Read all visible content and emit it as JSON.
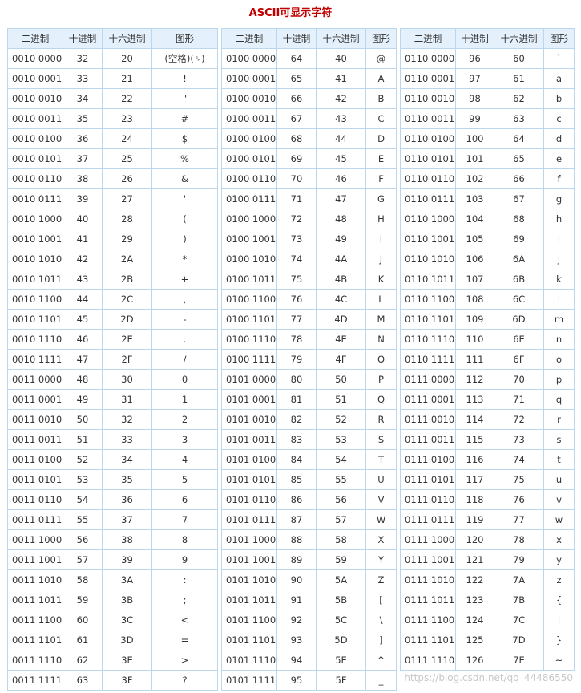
{
  "page": {
    "title": "ASCII可显示字符",
    "watermark": "https://blog.csdn.net/qq_44486550"
  },
  "headers": [
    "二进制",
    "十进制",
    "十六进制",
    "图形"
  ],
  "tables": [
    {
      "rows": [
        [
          "0010 0000",
          "32",
          "20",
          "(空格)(␠)"
        ],
        [
          "0010 0001",
          "33",
          "21",
          "!"
        ],
        [
          "0010 0010",
          "34",
          "22",
          "\""
        ],
        [
          "0010 0011",
          "35",
          "23",
          "#"
        ],
        [
          "0010 0100",
          "36",
          "24",
          "$"
        ],
        [
          "0010 0101",
          "37",
          "25",
          "%"
        ],
        [
          "0010 0110",
          "38",
          "26",
          "&"
        ],
        [
          "0010 0111",
          "39",
          "27",
          "'"
        ],
        [
          "0010 1000",
          "40",
          "28",
          "("
        ],
        [
          "0010 1001",
          "41",
          "29",
          ")"
        ],
        [
          "0010 1010",
          "42",
          "2A",
          "*"
        ],
        [
          "0010 1011",
          "43",
          "2B",
          "+"
        ],
        [
          "0010 1100",
          "44",
          "2C",
          ","
        ],
        [
          "0010 1101",
          "45",
          "2D",
          "-"
        ],
        [
          "0010 1110",
          "46",
          "2E",
          "."
        ],
        [
          "0010 1111",
          "47",
          "2F",
          "/"
        ],
        [
          "0011 0000",
          "48",
          "30",
          "0"
        ],
        [
          "0011 0001",
          "49",
          "31",
          "1"
        ],
        [
          "0011 0010",
          "50",
          "32",
          "2"
        ],
        [
          "0011 0011",
          "51",
          "33",
          "3"
        ],
        [
          "0011 0100",
          "52",
          "34",
          "4"
        ],
        [
          "0011 0101",
          "53",
          "35",
          "5"
        ],
        [
          "0011 0110",
          "54",
          "36",
          "6"
        ],
        [
          "0011 0111",
          "55",
          "37",
          "7"
        ],
        [
          "0011 1000",
          "56",
          "38",
          "8"
        ],
        [
          "0011 1001",
          "57",
          "39",
          "9"
        ],
        [
          "0011 1010",
          "58",
          "3A",
          ":"
        ],
        [
          "0011 1011",
          "59",
          "3B",
          ";"
        ],
        [
          "0011 1100",
          "60",
          "3C",
          "<"
        ],
        [
          "0011 1101",
          "61",
          "3D",
          "="
        ],
        [
          "0011 1110",
          "62",
          "3E",
          ">"
        ],
        [
          "0011 1111",
          "63",
          "3F",
          "?"
        ]
      ]
    },
    {
      "rows": [
        [
          "0100 0000",
          "64",
          "40",
          "@"
        ],
        [
          "0100 0001",
          "65",
          "41",
          "A"
        ],
        [
          "0100 0010",
          "66",
          "42",
          "B"
        ],
        [
          "0100 0011",
          "67",
          "43",
          "C"
        ],
        [
          "0100 0100",
          "68",
          "44",
          "D"
        ],
        [
          "0100 0101",
          "69",
          "45",
          "E"
        ],
        [
          "0100 0110",
          "70",
          "46",
          "F"
        ],
        [
          "0100 0111",
          "71",
          "47",
          "G"
        ],
        [
          "0100 1000",
          "72",
          "48",
          "H"
        ],
        [
          "0100 1001",
          "73",
          "49",
          "I"
        ],
        [
          "0100 1010",
          "74",
          "4A",
          "J"
        ],
        [
          "0100 1011",
          "75",
          "4B",
          "K"
        ],
        [
          "0100 1100",
          "76",
          "4C",
          "L"
        ],
        [
          "0100 1101",
          "77",
          "4D",
          "M"
        ],
        [
          "0100 1110",
          "78",
          "4E",
          "N"
        ],
        [
          "0100 1111",
          "79",
          "4F",
          "O"
        ],
        [
          "0101 0000",
          "80",
          "50",
          "P"
        ],
        [
          "0101 0001",
          "81",
          "51",
          "Q"
        ],
        [
          "0101 0010",
          "82",
          "52",
          "R"
        ],
        [
          "0101 0011",
          "83",
          "53",
          "S"
        ],
        [
          "0101 0100",
          "84",
          "54",
          "T"
        ],
        [
          "0101 0101",
          "85",
          "55",
          "U"
        ],
        [
          "0101 0110",
          "86",
          "56",
          "V"
        ],
        [
          "0101 0111",
          "87",
          "57",
          "W"
        ],
        [
          "0101 1000",
          "88",
          "58",
          "X"
        ],
        [
          "0101 1001",
          "89",
          "59",
          "Y"
        ],
        [
          "0101 1010",
          "90",
          "5A",
          "Z"
        ],
        [
          "0101 1011",
          "91",
          "5B",
          "["
        ],
        [
          "0101 1100",
          "92",
          "5C",
          "\\"
        ],
        [
          "0101 1101",
          "93",
          "5D",
          "]"
        ],
        [
          "0101 1110",
          "94",
          "5E",
          "^"
        ],
        [
          "0101 1111",
          "95",
          "5F",
          "_"
        ]
      ]
    },
    {
      "rows": [
        [
          "0110 0000",
          "96",
          "60",
          "`"
        ],
        [
          "0110 0001",
          "97",
          "61",
          "a"
        ],
        [
          "0110 0010",
          "98",
          "62",
          "b"
        ],
        [
          "0110 0011",
          "99",
          "63",
          "c"
        ],
        [
          "0110 0100",
          "100",
          "64",
          "d"
        ],
        [
          "0110 0101",
          "101",
          "65",
          "e"
        ],
        [
          "0110 0110",
          "102",
          "66",
          "f"
        ],
        [
          "0110 0111",
          "103",
          "67",
          "g"
        ],
        [
          "0110 1000",
          "104",
          "68",
          "h"
        ],
        [
          "0110 1001",
          "105",
          "69",
          "i"
        ],
        [
          "0110 1010",
          "106",
          "6A",
          "j"
        ],
        [
          "0110 1011",
          "107",
          "6B",
          "k"
        ],
        [
          "0110 1100",
          "108",
          "6C",
          "l"
        ],
        [
          "0110 1101",
          "109",
          "6D",
          "m"
        ],
        [
          "0110 1110",
          "110",
          "6E",
          "n"
        ],
        [
          "0110 1111",
          "111",
          "6F",
          "o"
        ],
        [
          "0111 0000",
          "112",
          "70",
          "p"
        ],
        [
          "0111 0001",
          "113",
          "71",
          "q"
        ],
        [
          "0111 0010",
          "114",
          "72",
          "r"
        ],
        [
          "0111 0011",
          "115",
          "73",
          "s"
        ],
        [
          "0111 0100",
          "116",
          "74",
          "t"
        ],
        [
          "0111 0101",
          "117",
          "75",
          "u"
        ],
        [
          "0111 0110",
          "118",
          "76",
          "v"
        ],
        [
          "0111 0111",
          "119",
          "77",
          "w"
        ],
        [
          "0111 1000",
          "120",
          "78",
          "x"
        ],
        [
          "0111 1001",
          "121",
          "79",
          "y"
        ],
        [
          "0111 1010",
          "122",
          "7A",
          "z"
        ],
        [
          "0111 1011",
          "123",
          "7B",
          "{"
        ],
        [
          "0111 1100",
          "124",
          "7C",
          "|"
        ],
        [
          "0111 1101",
          "125",
          "7D",
          "}"
        ],
        [
          "0111 1110",
          "126",
          "7E",
          "~"
        ]
      ]
    }
  ]
}
